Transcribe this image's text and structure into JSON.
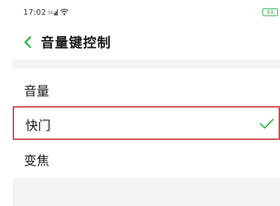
{
  "status_bar": {
    "time": "17:02",
    "signal": "signal-icon",
    "wifi": "wifi-icon",
    "battery_level": "59",
    "battery_color": "#2db24a"
  },
  "header": {
    "back_icon": "chevron-left-icon",
    "title": "音量键控制"
  },
  "options": [
    {
      "label": "音量",
      "selected": false
    },
    {
      "label": "快门",
      "selected": true
    },
    {
      "label": "变焦",
      "selected": false
    }
  ],
  "colors": {
    "accent": "#2db24a",
    "highlight_border": "#d04a4a",
    "section_bg": "#f3f3f3"
  }
}
